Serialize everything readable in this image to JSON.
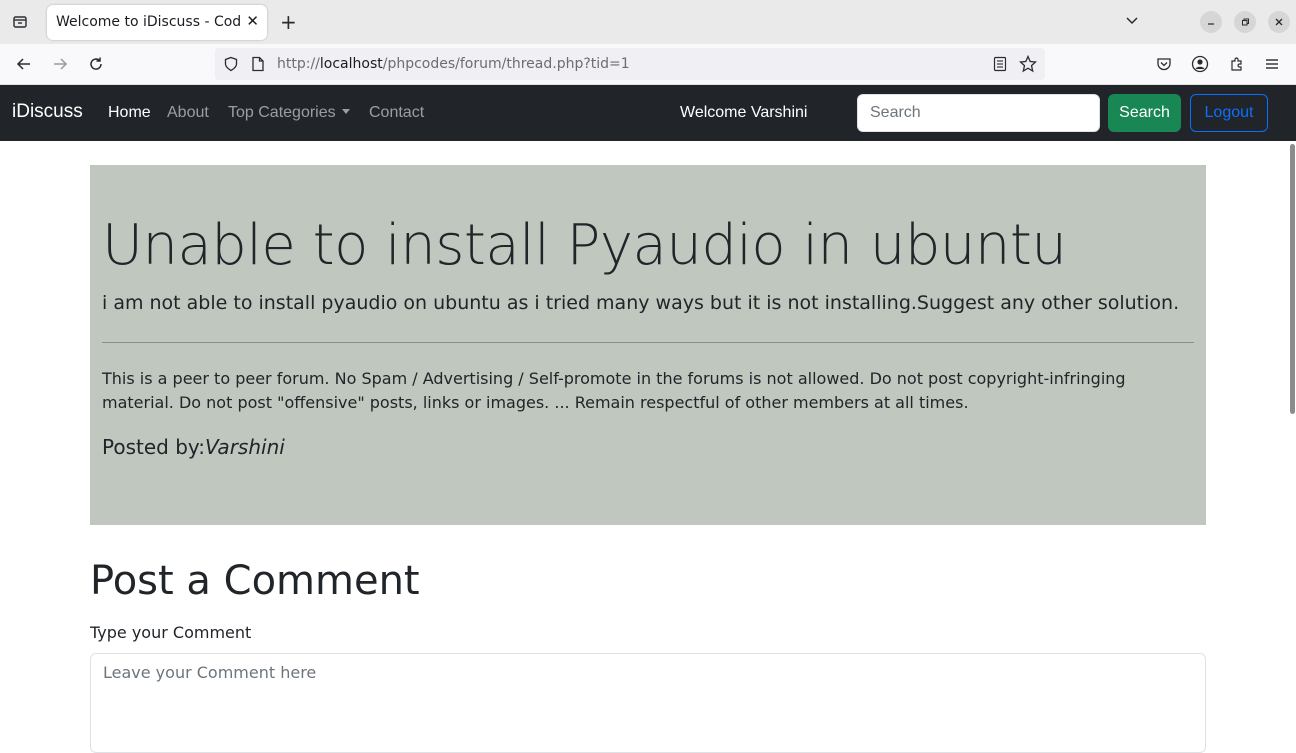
{
  "browser": {
    "tab_title": "Welcome to iDiscuss - Coding Forums",
    "tab_close": "✕",
    "new_tab": "+",
    "url_prefix": "http://",
    "url_host": "localhost",
    "url_path": "/phpcodes/forum/thread.php?tid=1",
    "icons": [
      "tab-list-icon",
      "back-icon",
      "forward-icon",
      "reload-icon",
      "shield-icon",
      "page-icon",
      "reader-view-icon",
      "bookmark-star-icon",
      "pocket-icon",
      "account-icon",
      "extensions-icon",
      "menu-icon",
      "chevron-down-icon",
      "minimize-icon",
      "restore-icon",
      "close-icon"
    ]
  },
  "navbar": {
    "brand": "iDiscuss",
    "links": [
      "Home",
      "About",
      "Top Categories",
      "Contact"
    ],
    "welcome": "Welcome Varshini",
    "search_placeholder": "Search",
    "search_button": "Search",
    "logout_button": "Logout"
  },
  "thread": {
    "title": "Unable to install Pyaudio in ubuntu",
    "description": "i am not able to install pyaudio on ubuntu as i tried many ways but it is not installing.Suggest any other solution.",
    "rules": "This is a peer to peer forum. No Spam / Advertising / Self-promote in the forums is not allowed. Do not post copyright-infringing material. Do not post \"offensive\" posts, links or images. ... Remain respectful of other members at all times.",
    "posted_by_label": "Posted by:",
    "posted_by_name": "Varshini"
  },
  "comment": {
    "heading": "Post a Comment",
    "label": "Type your Comment",
    "placeholder": "Leave your Comment here"
  },
  "colors": {
    "navbar_bg": "#212529",
    "jumbotron_bg": "#bfc7bf",
    "search_button": "#198754",
    "logout_outline": "#0d6efd"
  }
}
